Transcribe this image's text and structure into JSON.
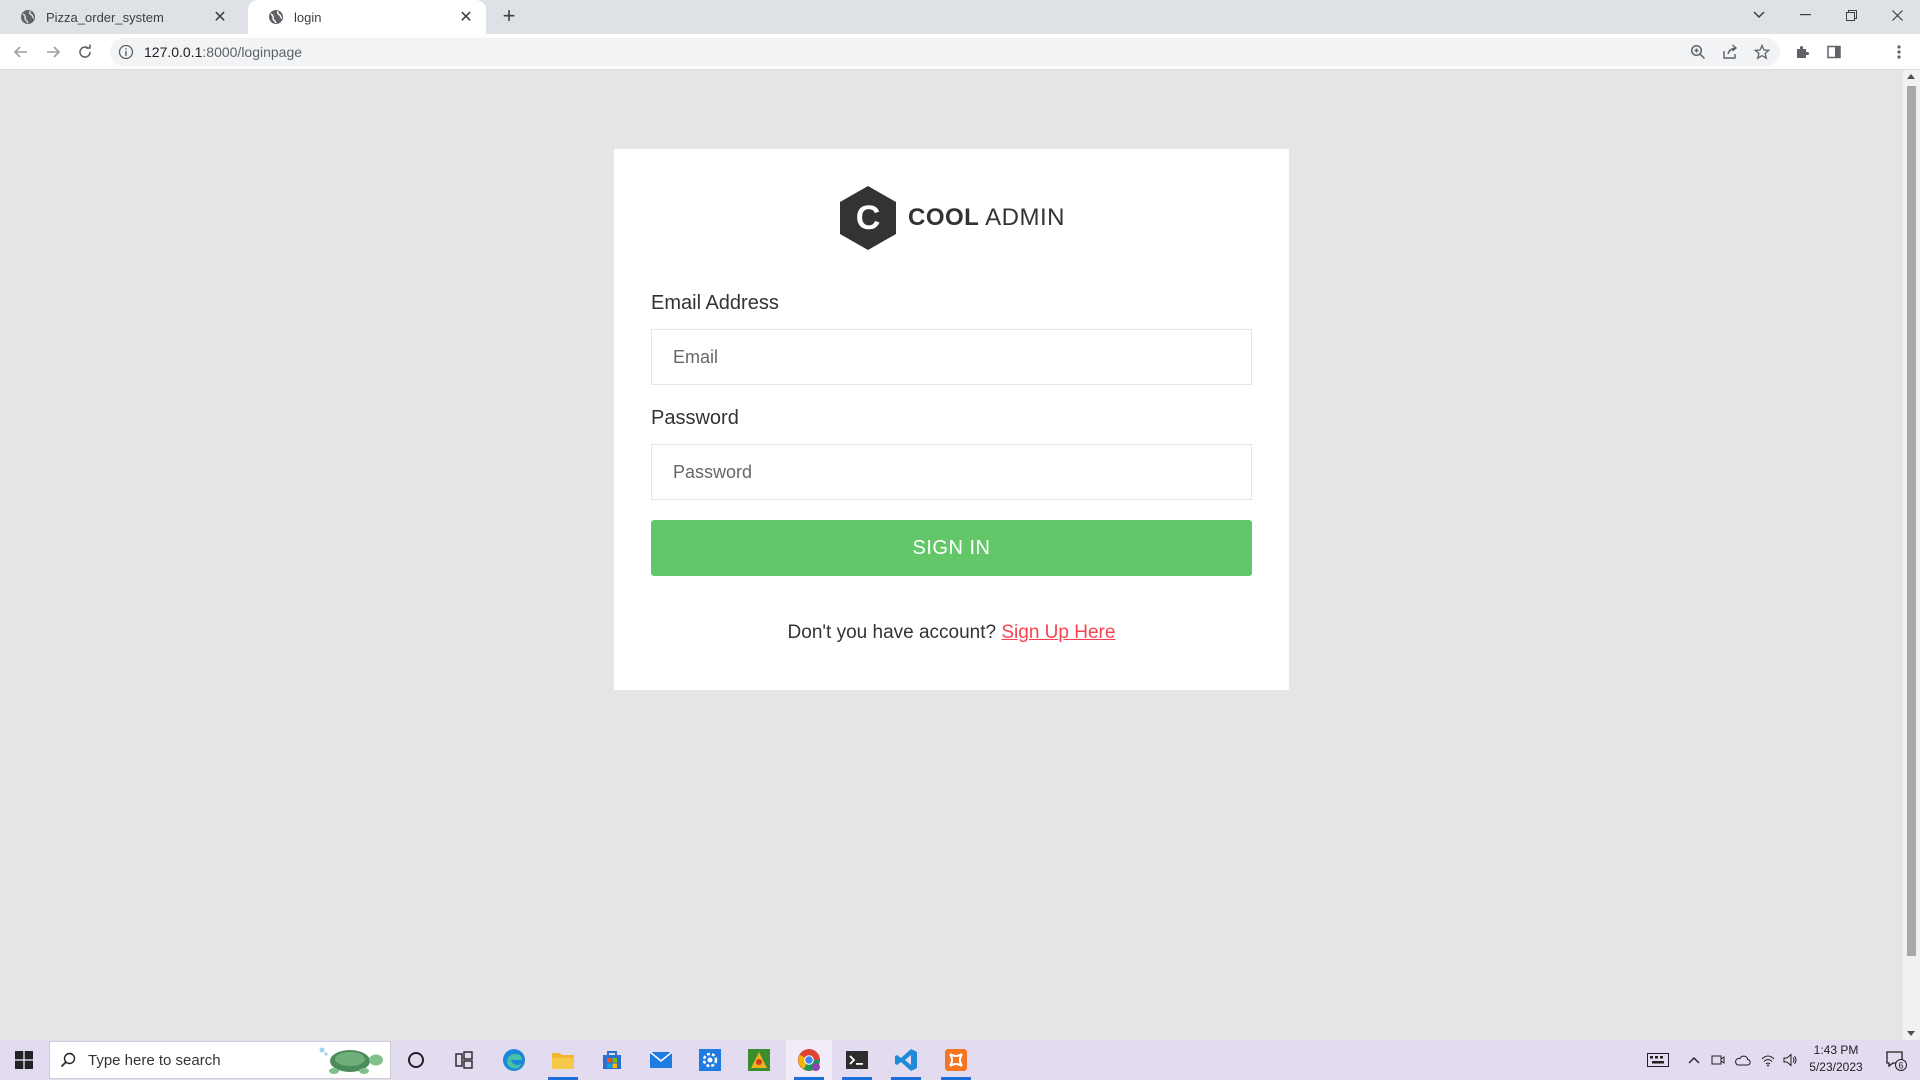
{
  "browser": {
    "tabs": [
      {
        "title": "Pizza_order_system",
        "active": false
      },
      {
        "title": "login",
        "active": true
      }
    ],
    "address": {
      "host": "127.0.0.1",
      "path": ":8000/loginpage"
    }
  },
  "page": {
    "logo": {
      "mark": "C",
      "brand_bold": "COOL",
      "brand_light": "ADMIN"
    },
    "email": {
      "label": "Email Address",
      "placeholder": "Email"
    },
    "password": {
      "label": "Password",
      "placeholder": "Password"
    },
    "submit_label": "SIGN IN",
    "register": {
      "prompt": "Don't you have account? ",
      "link": "Sign Up Here"
    }
  },
  "taskbar": {
    "search_placeholder": "Type here to search",
    "clock": {
      "time": "1:43 PM",
      "date": "5/23/2023"
    },
    "notification_count": "6"
  },
  "colors": {
    "signin_button": "#63c76a",
    "link": "#fa4251",
    "page_background": "#e5e5e5"
  }
}
